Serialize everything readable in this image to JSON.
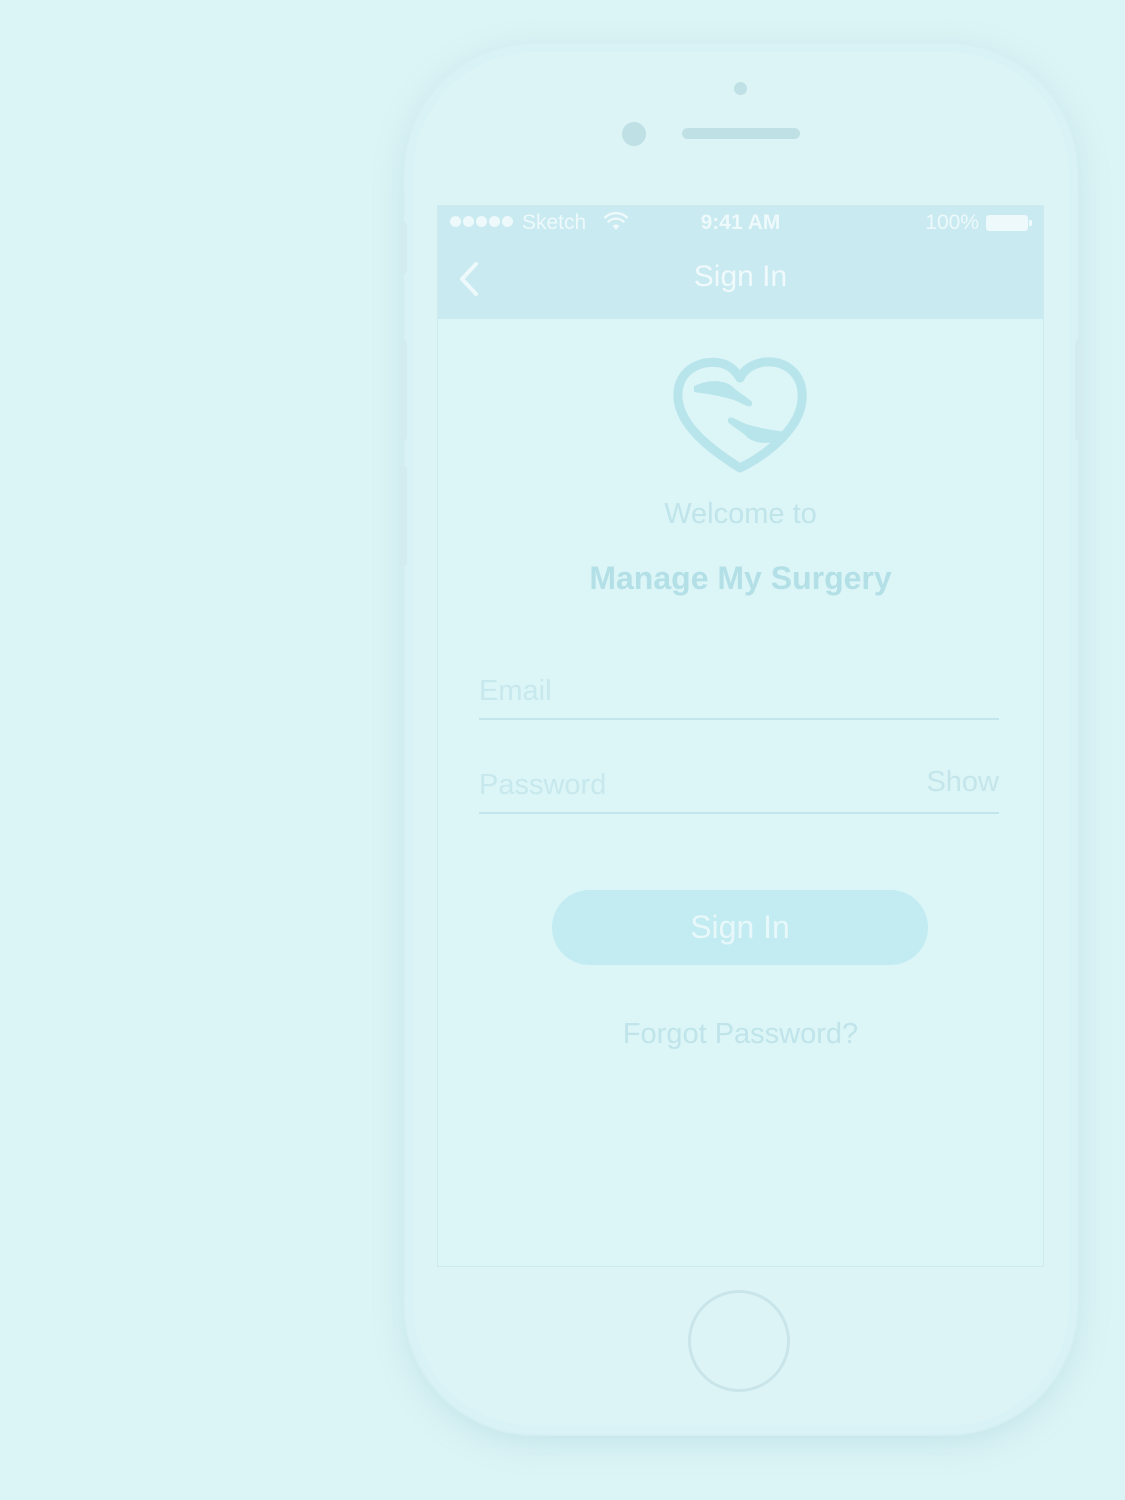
{
  "status_bar": {
    "carrier": "Sketch",
    "time": "9:41 AM",
    "battery": "100%",
    "signal_icon": "signal-dots-icon",
    "wifi_icon": "wifi-icon",
    "battery_icon": "battery-icon"
  },
  "nav": {
    "title": "Sign In",
    "back_icon": "chevron-left-icon"
  },
  "logo": {
    "icon": "heart-hands-logo-icon"
  },
  "welcome": {
    "line1": "Welcome to",
    "app_name": "Manage My Surgery"
  },
  "form": {
    "email_placeholder": "Email",
    "email_value": "",
    "password_placeholder": "Password",
    "password_value": "",
    "show_label": "Show"
  },
  "actions": {
    "sign_in_label": "Sign In",
    "forgot_label": "Forgot Password?"
  },
  "colors": {
    "background": "#dbf4f6",
    "header": "#c8eaf0",
    "accent": "#b3dfe7",
    "button": "#c2ecf1"
  }
}
